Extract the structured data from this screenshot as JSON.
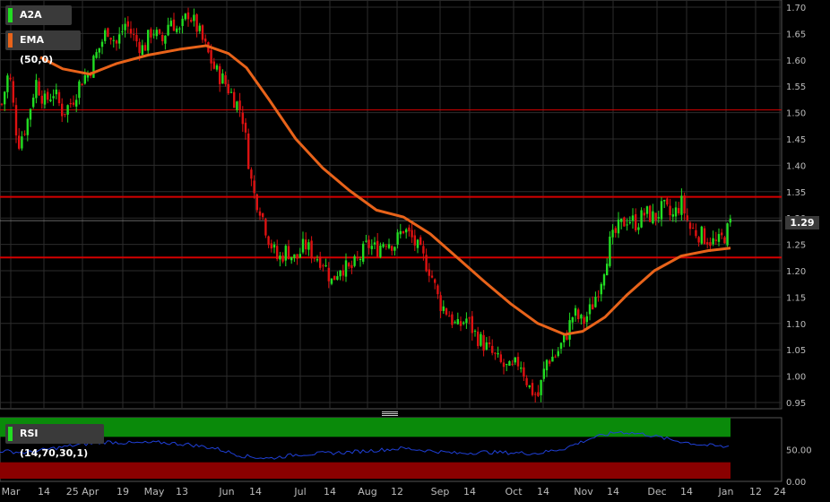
{
  "legend": {
    "symbol": "A2A SpA",
    "ema_label": "EMA (50,0)",
    "rsi_label": "RSI (14,70,30,1)"
  },
  "last_price": "1.29",
  "colors": {
    "background": "#000000",
    "grid": "#2c2c2c",
    "up_candle": "#22dd22",
    "down_candle": "#dd1111",
    "ema": "#e8631a",
    "horizontal_lines": "#d40000",
    "rsi_line": "#1f3fd6",
    "rsi_overbought_zone": "#0a8a0a",
    "rsi_oversold_zone": "#8a0000"
  },
  "chart_data": {
    "type": "candlestick",
    "y_ticks": [
      "1.70",
      "1.65",
      "1.60",
      "1.55",
      "1.50",
      "1.45",
      "1.40",
      "1.35",
      "1.30",
      "1.25",
      "1.20",
      "1.15",
      "1.10",
      "1.05",
      "1.00",
      "0.95"
    ],
    "ylim": [
      0.94,
      1.71
    ],
    "x_ticks": [
      "Mar",
      "14",
      "25 Apr",
      "19",
      "May",
      "13",
      "Jun",
      "14",
      "Jul",
      "14",
      "Aug",
      "12",
      "Sep",
      "14",
      "Oct",
      "14",
      "Nov",
      "14",
      "Dec",
      "14",
      "Jan",
      "12",
      "24"
    ],
    "horizontal_lines": [
      1.505,
      1.34,
      1.225
    ],
    "close_path": [
      [
        0,
        1.5
      ],
      [
        10,
        1.58
      ],
      [
        20,
        1.44
      ],
      [
        30,
        1.48
      ],
      [
        40,
        1.56
      ],
      [
        50,
        1.52
      ],
      [
        60,
        1.54
      ],
      [
        70,
        1.5
      ],
      [
        80,
        1.52
      ],
      [
        90,
        1.56
      ],
      [
        100,
        1.58
      ],
      [
        110,
        1.62
      ],
      [
        120,
        1.66
      ],
      [
        130,
        1.63
      ],
      [
        140,
        1.67
      ],
      [
        150,
        1.64
      ],
      [
        160,
        1.62
      ],
      [
        170,
        1.66
      ],
      [
        180,
        1.63
      ],
      [
        190,
        1.68
      ],
      [
        200,
        1.65
      ],
      [
        210,
        1.69
      ],
      [
        220,
        1.66
      ],
      [
        230,
        1.62
      ],
      [
        240,
        1.58
      ],
      [
        250,
        1.56
      ],
      [
        260,
        1.53
      ],
      [
        270,
        1.5
      ],
      [
        278,
        1.4
      ],
      [
        282,
        1.35
      ],
      [
        290,
        1.32
      ],
      [
        300,
        1.26
      ],
      [
        310,
        1.22
      ],
      [
        320,
        1.24
      ],
      [
        330,
        1.22
      ],
      [
        340,
        1.25
      ],
      [
        350,
        1.23
      ],
      [
        360,
        1.22
      ],
      [
        370,
        1.18
      ],
      [
        380,
        1.21
      ],
      [
        390,
        1.2
      ],
      [
        400,
        1.22
      ],
      [
        410,
        1.25
      ],
      [
        420,
        1.24
      ],
      [
        430,
        1.26
      ],
      [
        440,
        1.25
      ],
      [
        450,
        1.28
      ],
      [
        460,
        1.26
      ],
      [
        470,
        1.23
      ],
      [
        480,
        1.2
      ],
      [
        490,
        1.14
      ],
      [
        500,
        1.12
      ],
      [
        510,
        1.09
      ],
      [
        520,
        1.11
      ],
      [
        530,
        1.08
      ],
      [
        540,
        1.06
      ],
      [
        550,
        1.04
      ],
      [
        560,
        1.02
      ],
      [
        570,
        1.01
      ],
      [
        580,
        1.03
      ],
      [
        590,
        0.98
      ],
      [
        600,
        0.96
      ],
      [
        610,
        1.03
      ],
      [
        620,
        1.04
      ],
      [
        630,
        1.07
      ],
      [
        640,
        1.12
      ],
      [
        650,
        1.1
      ],
      [
        660,
        1.13
      ],
      [
        670,
        1.18
      ],
      [
        680,
        1.25
      ],
      [
        690,
        1.28
      ],
      [
        700,
        1.3
      ],
      [
        710,
        1.29
      ],
      [
        720,
        1.31
      ],
      [
        730,
        1.3
      ],
      [
        740,
        1.32
      ],
      [
        750,
        1.3
      ],
      [
        760,
        1.33
      ],
      [
        770,
        1.28
      ],
      [
        780,
        1.27
      ],
      [
        790,
        1.26
      ],
      [
        800,
        1.25
      ],
      [
        810,
        1.27
      ],
      [
        815,
        1.29
      ]
    ],
    "ema_path": [
      [
        45,
        1.605
      ],
      [
        70,
        1.583
      ],
      [
        100,
        1.573
      ],
      [
        130,
        1.593
      ],
      [
        165,
        1.609
      ],
      [
        200,
        1.62
      ],
      [
        230,
        1.627
      ],
      [
        255,
        1.612
      ],
      [
        275,
        1.585
      ],
      [
        300,
        1.525
      ],
      [
        330,
        1.45
      ],
      [
        360,
        1.395
      ],
      [
        390,
        1.352
      ],
      [
        420,
        1.315
      ],
      [
        450,
        1.302
      ],
      [
        480,
        1.27
      ],
      [
        510,
        1.225
      ],
      [
        540,
        1.18
      ],
      [
        570,
        1.137
      ],
      [
        600,
        1.1
      ],
      [
        630,
        1.079
      ],
      [
        650,
        1.085
      ],
      [
        675,
        1.112
      ],
      [
        700,
        1.155
      ],
      [
        730,
        1.2
      ],
      [
        760,
        1.228
      ],
      [
        790,
        1.238
      ],
      [
        815,
        1.243
      ]
    ],
    "rsi": {
      "ticks": [
        "50.00",
        "0.00"
      ],
      "ylim": [
        0,
        100
      ],
      "overbought": 70,
      "oversold": 30,
      "path": [
        [
          0,
          48
        ],
        [
          30,
          45
        ],
        [
          60,
          52
        ],
        [
          90,
          58
        ],
        [
          120,
          62
        ],
        [
          150,
          60
        ],
        [
          180,
          61
        ],
        [
          210,
          58
        ],
        [
          240,
          52
        ],
        [
          270,
          40
        ],
        [
          300,
          36
        ],
        [
          330,
          42
        ],
        [
          360,
          44
        ],
        [
          390,
          46
        ],
        [
          420,
          49
        ],
        [
          450,
          52
        ],
        [
          480,
          48
        ],
        [
          510,
          44
        ],
        [
          540,
          46
        ],
        [
          570,
          45
        ],
        [
          600,
          44
        ],
        [
          630,
          52
        ],
        [
          660,
          68
        ],
        [
          690,
          78
        ],
        [
          720,
          74
        ],
        [
          750,
          65
        ],
        [
          780,
          58
        ],
        [
          810,
          54
        ],
        [
          815,
          57
        ]
      ]
    }
  }
}
